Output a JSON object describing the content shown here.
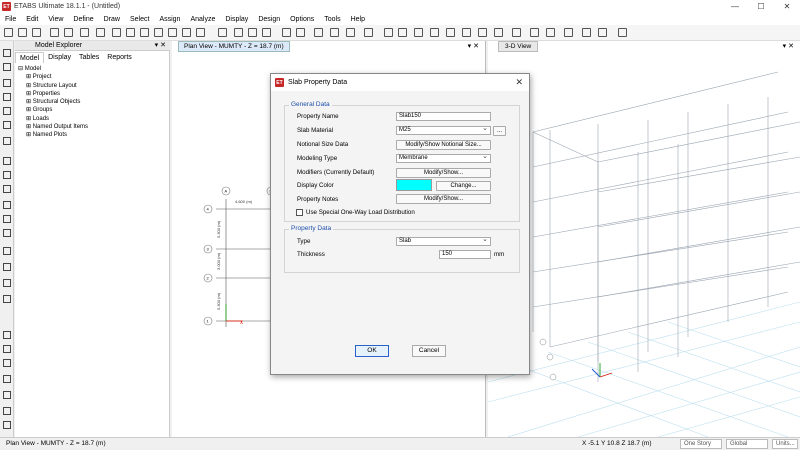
{
  "window": {
    "app_icon_text": "ET",
    "title": "ETABS Ultimate 18.1.1 - (Untitled)",
    "controls": [
      "—",
      "☐",
      "✕"
    ]
  },
  "menu": [
    "File",
    "Edit",
    "View",
    "Define",
    "Draw",
    "Select",
    "Assign",
    "Analyze",
    "Display",
    "Design",
    "Options",
    "Tools",
    "Help"
  ],
  "explorer": {
    "title": "Model Explorer",
    "pin": "▾ ✕",
    "tabs": [
      "Model",
      "Display",
      "Tables",
      "Reports"
    ],
    "tree_root": "Model",
    "tree_items": [
      "Project",
      "Structure Layout",
      "Properties",
      "Structural Objects",
      "Groups",
      "Loads",
      "Named Output Items",
      "Named Plots"
    ]
  },
  "plan_view": {
    "tab_label": "Plan View - MUMTY - Z = 18.7 (m)",
    "tab_controls": "▾ ✕",
    "grid_bubbles_top": [
      "A",
      "B"
    ],
    "grid_bubbles_left": [
      "4",
      "3",
      "2",
      "1"
    ],
    "dim_top": "4.600 (m)",
    "dims_left": [
      "5.300 (m)",
      "3.000 (m)",
      "5.300 (m)"
    ]
  },
  "view_3d": {
    "tab_label": "3-D View",
    "tab_controls": "▾ ✕"
  },
  "dialog": {
    "app_icon_text": "ET",
    "title": "Slab Property Data",
    "close": "✕",
    "general_group": "General Data",
    "property_name_label": "Property Name",
    "property_name_value": "Slab150",
    "slab_material_label": "Slab Material",
    "slab_material_value": "M25",
    "material_ellipsis": "...",
    "notional_label": "Notional Size Data",
    "notional_button": "Modify/Show Notional Size...",
    "modeling_type_label": "Modeling Type",
    "modeling_type_value": "Membrane",
    "modifiers_label": "Modifiers (Currently Default)",
    "modifiers_button": "Modify/Show...",
    "display_color_label": "Display Color",
    "display_color_value": "#00ffff",
    "change_button": "Change...",
    "notes_label": "Property Notes",
    "notes_button": "Modify/Show...",
    "one_way_label": "Use Special One-Way Load Distribution",
    "property_group": "Property Data",
    "type_label": "Type",
    "type_value": "Slab",
    "thickness_label": "Thickness",
    "thickness_value": "150",
    "thickness_unit": "mm",
    "ok": "OK",
    "cancel": "Cancel"
  },
  "status": {
    "left": "Plan View - MUMTY - Z = 18.7 (m)",
    "coords": "X -5.1  Y 10.8  Z 18.7 (m)",
    "story": "One Story",
    "coord_sys": "Global",
    "units": "Units..."
  },
  "colors": {
    "accent": "#2a62c9",
    "display_color": "#00ffff",
    "grid_3d": "#9aa4b0",
    "floor_grid": "#bfe0f0"
  }
}
